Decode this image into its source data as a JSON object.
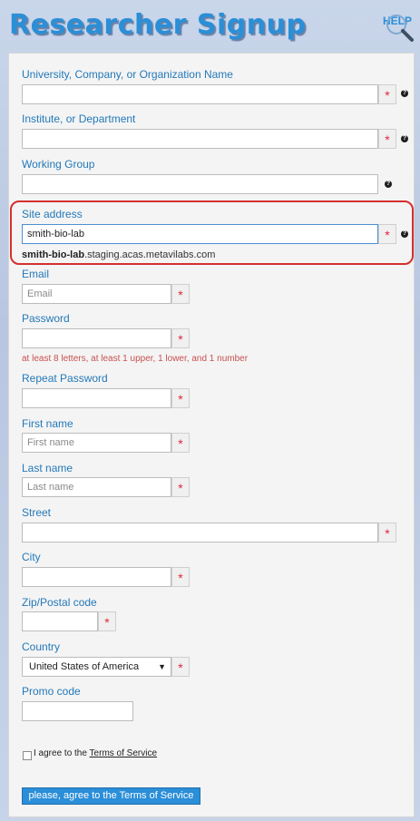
{
  "page": {
    "title": "Researcher Signup",
    "help_label": "HELP"
  },
  "form": {
    "organization": {
      "label": "University, Company, or Organization Name",
      "value": ""
    },
    "institute": {
      "label": "Institute, or Department",
      "value": ""
    },
    "working_group": {
      "label": "Working Group",
      "value": ""
    },
    "site_address": {
      "label": "Site address",
      "value": "smith-bio-lab",
      "subdomain": "smith-bio-lab",
      "domain_suffix": ".staging.acas.metavilabs.com"
    },
    "email": {
      "label": "Email",
      "placeholder": "Email"
    },
    "password": {
      "label": "Password",
      "value": "",
      "hint": "at least 8 letters, at least 1 upper, 1 lower, and 1 number"
    },
    "repeat_password": {
      "label": "Repeat Password",
      "value": ""
    },
    "first_name": {
      "label": "First name",
      "placeholder": "First name"
    },
    "last_name": {
      "label": "Last name",
      "placeholder": "Last name"
    },
    "street": {
      "label": "Street",
      "value": ""
    },
    "city": {
      "label": "City",
      "value": ""
    },
    "zip": {
      "label": "Zip/Postal code",
      "value": ""
    },
    "country": {
      "label": "Country",
      "selected": "United States of America"
    },
    "promo": {
      "label": "Promo code",
      "value": ""
    },
    "terms": {
      "prefix": "I agree to the",
      "link": "Terms of Service",
      "checked": false
    },
    "submit_label": "please, agree to the Terms of Service",
    "required_marker": "*",
    "info_marker": "?"
  },
  "colors": {
    "accent": "#2a8fd6",
    "required": "#e0283c",
    "highlight": "#d43030"
  }
}
